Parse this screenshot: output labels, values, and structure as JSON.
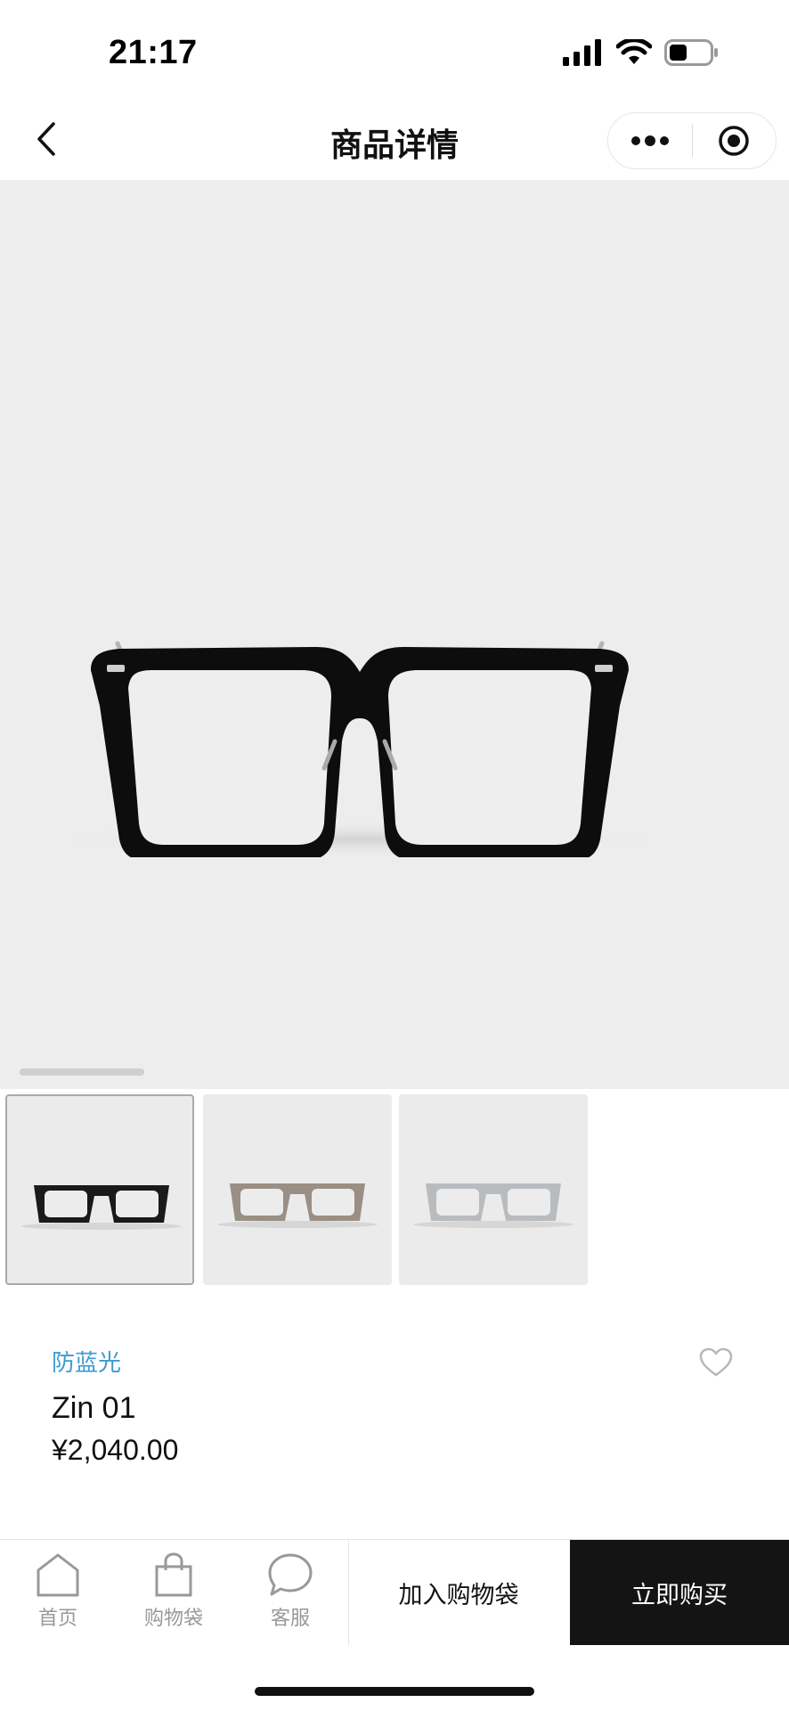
{
  "status_bar": {
    "time": "21:17",
    "icons": [
      "signal-icon",
      "wifi-icon",
      "battery-icon"
    ],
    "battery_level": 0.45
  },
  "nav": {
    "title": "商品详情",
    "back_icon": "chevron-left-icon",
    "more_icon": "more-dots-icon",
    "close_icon": "target-close-icon"
  },
  "gallery": {
    "images": [
      "glasses-black",
      "glasses-taupe",
      "glasses-clear"
    ],
    "selected_index": 0,
    "thumbnails": [
      {
        "color": "#1a1a1a",
        "selected": true
      },
      {
        "color": "#9a8f84",
        "selected": false
      },
      {
        "color": "#b9bcbf",
        "selected": false
      }
    ]
  },
  "product": {
    "tag": "防蓝光",
    "name": "Zin 01",
    "price": "¥2,040.00",
    "tag_color": "#3d9ad1"
  },
  "bottom_bar": {
    "tabs": [
      {
        "label": "首页",
        "icon": "home-icon"
      },
      {
        "label": "购物袋",
        "icon": "bag-icon"
      },
      {
        "label": "客服",
        "icon": "chat-bubble-icon"
      }
    ],
    "add_to_cart": "加入购物袋",
    "buy_now": "立即购买"
  }
}
